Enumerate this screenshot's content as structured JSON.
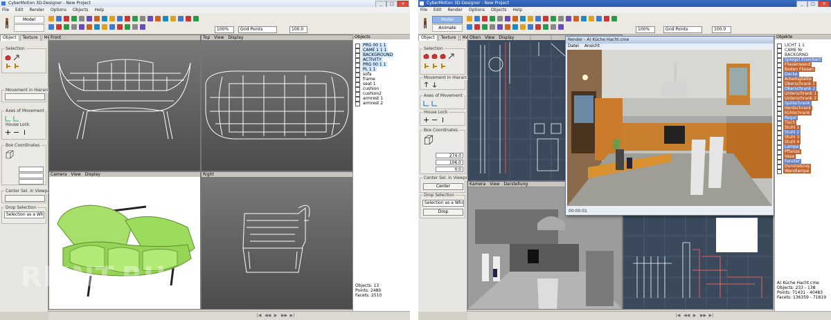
{
  "left_app": {
    "title": "CyberMotion 3D-Designer - New Project",
    "menu": [
      "File",
      "Edit",
      "Render",
      "Options",
      "Objects",
      "Help"
    ],
    "mode_tab": "Model",
    "zoom_value": "100%",
    "grid_value": "Grid Points",
    "step_value": "100.0",
    "panel_tabs": [
      "Object",
      "Texture",
      "Mesh"
    ],
    "groups": [
      "Selection",
      "Movement in Hierarchy",
      "Axes of Movement",
      "House Lock",
      "Box Coordinates",
      "Center Sel. in Viewport",
      "Drop Selection"
    ],
    "drop_value": "Selection as a Whole",
    "viewports": [
      {
        "label": "Front"
      },
      {
        "label": "Top",
        "menu": [
          "View",
          "Display"
        ]
      },
      {
        "label": "Camera",
        "menu": [
          "View",
          "Display"
        ]
      },
      {
        "label": "Right"
      }
    ],
    "objects_title": "Objects",
    "tree": [
      {
        "label": "PRG 00 1 1"
      },
      {
        "label": "CAME 1 1 1"
      },
      {
        "label": "BACKGROUND"
      },
      {
        "label": "ACTIVITY"
      },
      {
        "label": "PRG 00 1 1"
      },
      {
        "label": "PL 1 1"
      },
      {
        "label": "sofa"
      },
      {
        "label": "frame"
      },
      {
        "label": "seat 1"
      },
      {
        "label": "cushion"
      },
      {
        "label": "cushion2"
      },
      {
        "label": "armrest 1"
      },
      {
        "label": "armrest 2"
      }
    ],
    "stats": [
      "Objects: 13",
      "Points: 2480",
      "Facets: 2510"
    ]
  },
  "right_app": {
    "title": "CyberMotion 3D-Designer - New Project",
    "menu": [
      "File",
      "Edit",
      "Render",
      "Options",
      "Objects",
      "Help"
    ],
    "mode_tab": "Model",
    "mode_tab2": "Animate",
    "zoom_value": "100%",
    "grid_value": "Grid Points",
    "step_value": "100.0",
    "panel_tabs": [
      "Object",
      "Texture",
      "Mesh"
    ],
    "groups": [
      "Selection",
      "Movement in Hierarchy",
      "Axes of Movement",
      "House Lock",
      "Box Coordinates",
      "Center Sel. in Viewport",
      "Drop Selection"
    ],
    "box_coords": [
      "274.0",
      "106.0",
      "0.0"
    ],
    "center_btn": "Center",
    "drop_value": "Selection as a Whole",
    "drop_btn": "Drop",
    "viewports": [
      {
        "label": "Oben",
        "menu": [
          "View",
          "Display"
        ]
      },
      {
        "label": "Kamera",
        "menu": [
          "View",
          "Darstellung"
        ]
      }
    ],
    "render_title": "Render - A) Küche Hacht.cme",
    "render_menu": [
      "Datei",
      "Ansicht"
    ],
    "render_time": "00:00:01",
    "objects_title": "Objekte",
    "tree": [
      {
        "label": "LICHT 1 1"
      },
      {
        "label": "CAME Nr"
      },
      {
        "label": "BACKGRND"
      },
      {
        "label": "Spiegel Eisenbart"
      },
      {
        "label": "Fliesenwand"
      },
      {
        "label": "Boden Fliesen"
      },
      {
        "label": "Decke"
      },
      {
        "label": "Arbeitsplatte"
      },
      {
        "label": "Oberschrank 1"
      },
      {
        "label": "Oberschrank 2"
      },
      {
        "label": "Unterschrank 1"
      },
      {
        "label": "Unterschrank 2"
      },
      {
        "label": "Spülschrank"
      },
      {
        "label": "Herdschrank"
      },
      {
        "label": "Kühlschrank"
      },
      {
        "label": "Regal"
      },
      {
        "label": "Tisch"
      },
      {
        "label": "Stuhl 1"
      },
      {
        "label": "Stuhl 2"
      },
      {
        "label": "Stuhl 3"
      },
      {
        "label": "Stuhl 4"
      },
      {
        "label": "Lampe"
      },
      {
        "label": "Pflanze"
      },
      {
        "label": "Vase"
      },
      {
        "label": "Fenster"
      },
      {
        "label": "Dunstabzug"
      },
      {
        "label": "Wandlampe"
      }
    ],
    "file_label": "A) Küche Hacht.cme",
    "stats": [
      "Objects: 233 - 138",
      "Points: 71431 - 40483",
      "Facets: 136359 - 71819"
    ]
  },
  "watermark": "RMNT.RU",
  "colors": {
    "sofa_green": "#9be05a",
    "render_wall": "#b8b8b0",
    "highlight": "#c0632f"
  }
}
